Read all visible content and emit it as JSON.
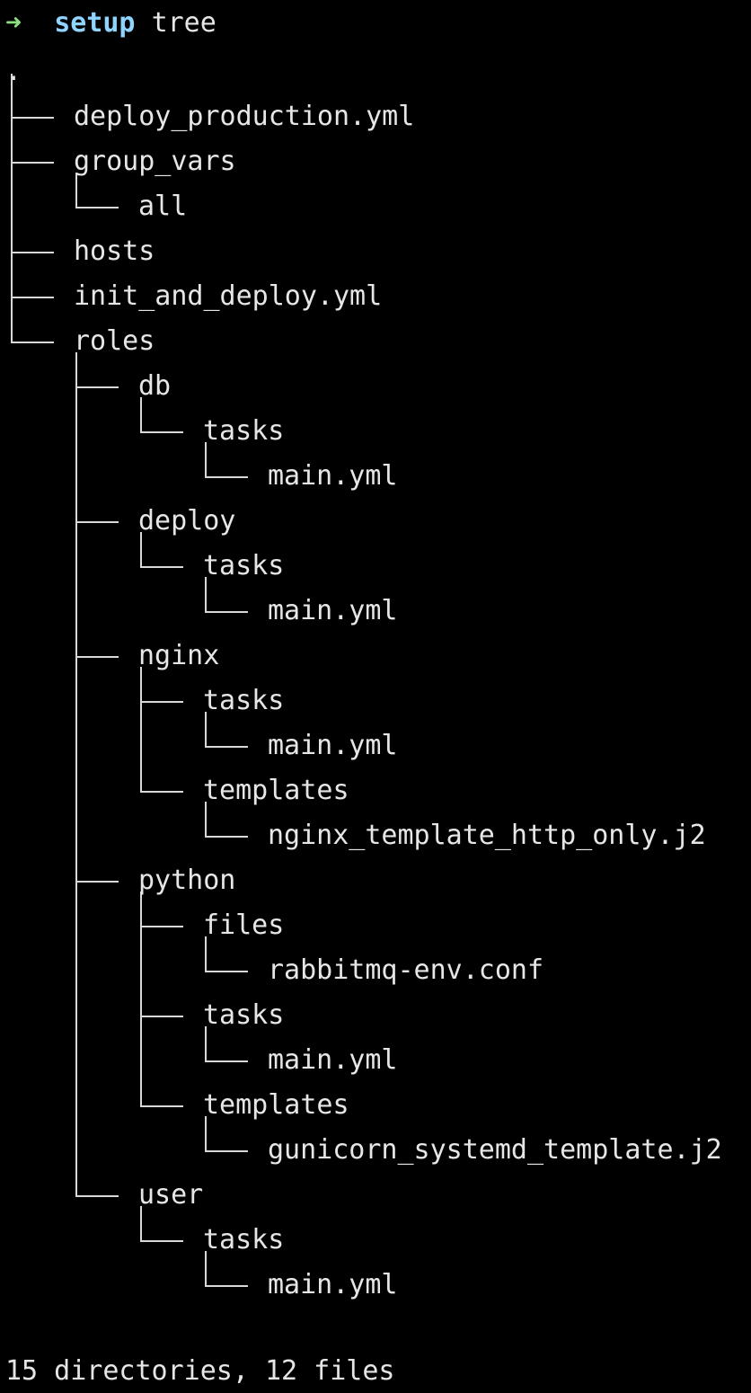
{
  "prompt": {
    "arrow": "➜",
    "directory": "setup",
    "command": "tree"
  },
  "tree": {
    "root": ".",
    "entries": [
      {
        "name": "deploy_production.yml",
        "depth": 1
      },
      {
        "name": "group_vars",
        "depth": 1
      },
      {
        "name": "all",
        "depth": 2
      },
      {
        "name": "hosts",
        "depth": 1
      },
      {
        "name": "init_and_deploy.yml",
        "depth": 1
      },
      {
        "name": "roles",
        "depth": 1
      },
      {
        "name": "db",
        "depth": 2
      },
      {
        "name": "tasks",
        "depth": 3
      },
      {
        "name": "main.yml",
        "depth": 4
      },
      {
        "name": "deploy",
        "depth": 2
      },
      {
        "name": "tasks",
        "depth": 3
      },
      {
        "name": "main.yml",
        "depth": 4
      },
      {
        "name": "nginx",
        "depth": 2
      },
      {
        "name": "tasks",
        "depth": 3
      },
      {
        "name": "main.yml",
        "depth": 4
      },
      {
        "name": "templates",
        "depth": 3
      },
      {
        "name": "nginx_template_http_only.j2",
        "depth": 4
      },
      {
        "name": "python",
        "depth": 2
      },
      {
        "name": "files",
        "depth": 3
      },
      {
        "name": "rabbitmq-env.conf",
        "depth": 4
      },
      {
        "name": "tasks",
        "depth": 3
      },
      {
        "name": "main.yml",
        "depth": 4
      },
      {
        "name": "templates",
        "depth": 3
      },
      {
        "name": "gunicorn_systemd_template.j2",
        "depth": 4
      },
      {
        "name": "user",
        "depth": 2
      },
      {
        "name": "tasks",
        "depth": 3
      },
      {
        "name": "main.yml",
        "depth": 4
      }
    ]
  },
  "summary": "15 directories, 12 files",
  "colors": {
    "background": "#000000",
    "text": "#e6e6e6",
    "prompt_arrow": "#8ee07e",
    "prompt_directory": "#8fd3ff",
    "tree_lines": "#d8d8d8"
  }
}
